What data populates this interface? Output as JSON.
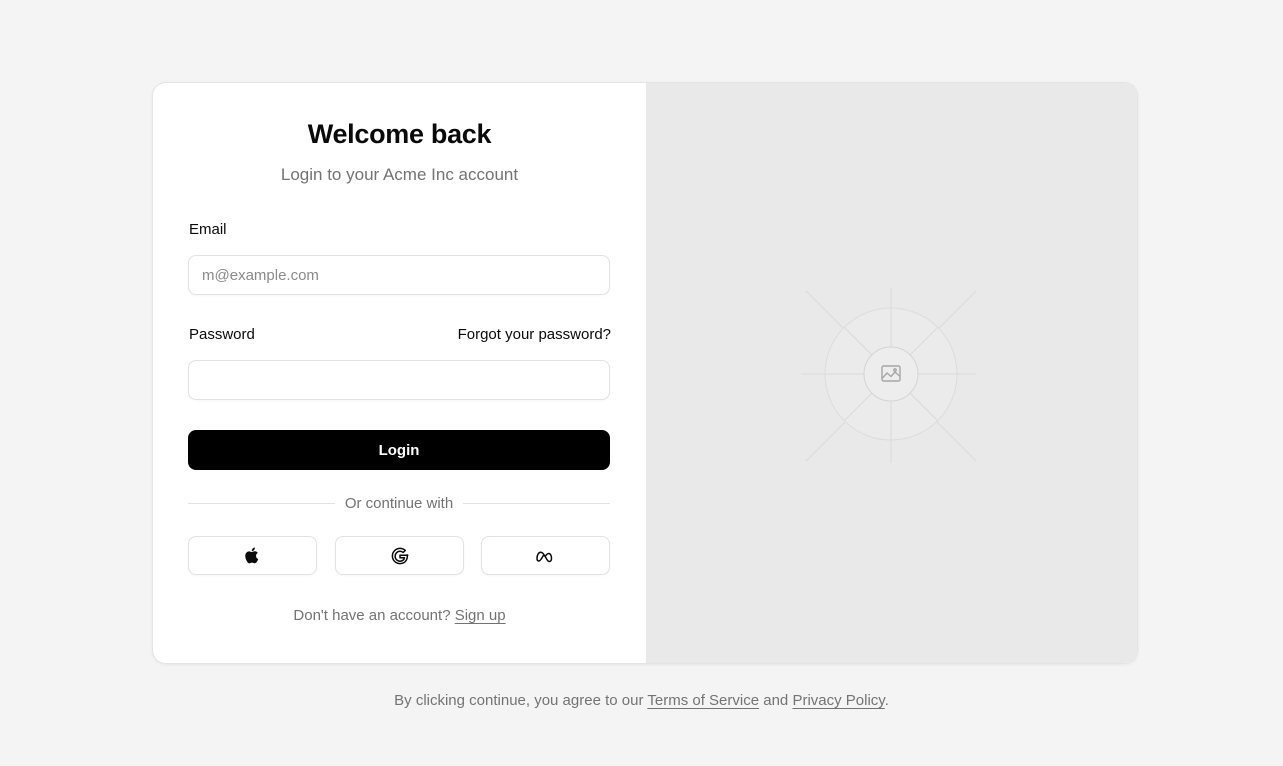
{
  "login": {
    "title": "Welcome back",
    "subtitle": "Login to your Acme Inc account",
    "email_label": "Email",
    "email_placeholder": "m@example.com",
    "email_value": "",
    "password_label": "Password",
    "password_value": "",
    "forgot_label": "Forgot your password?",
    "login_button": "Login",
    "divider_text": "Or continue with",
    "social": [
      {
        "provider": "Apple",
        "icon": "apple-icon"
      },
      {
        "provider": "Google",
        "icon": "google-icon"
      },
      {
        "provider": "Meta",
        "icon": "meta-icon"
      }
    ],
    "signup_prompt": "Don't have an account?",
    "signup_link": "Sign up"
  },
  "image_panel": {
    "icon": "image-placeholder-icon"
  },
  "footer": {
    "prefix": "By clicking continue, you agree to our",
    "terms": "Terms of Service",
    "conjunction": "and",
    "privacy": "Privacy Policy",
    "suffix": "."
  }
}
